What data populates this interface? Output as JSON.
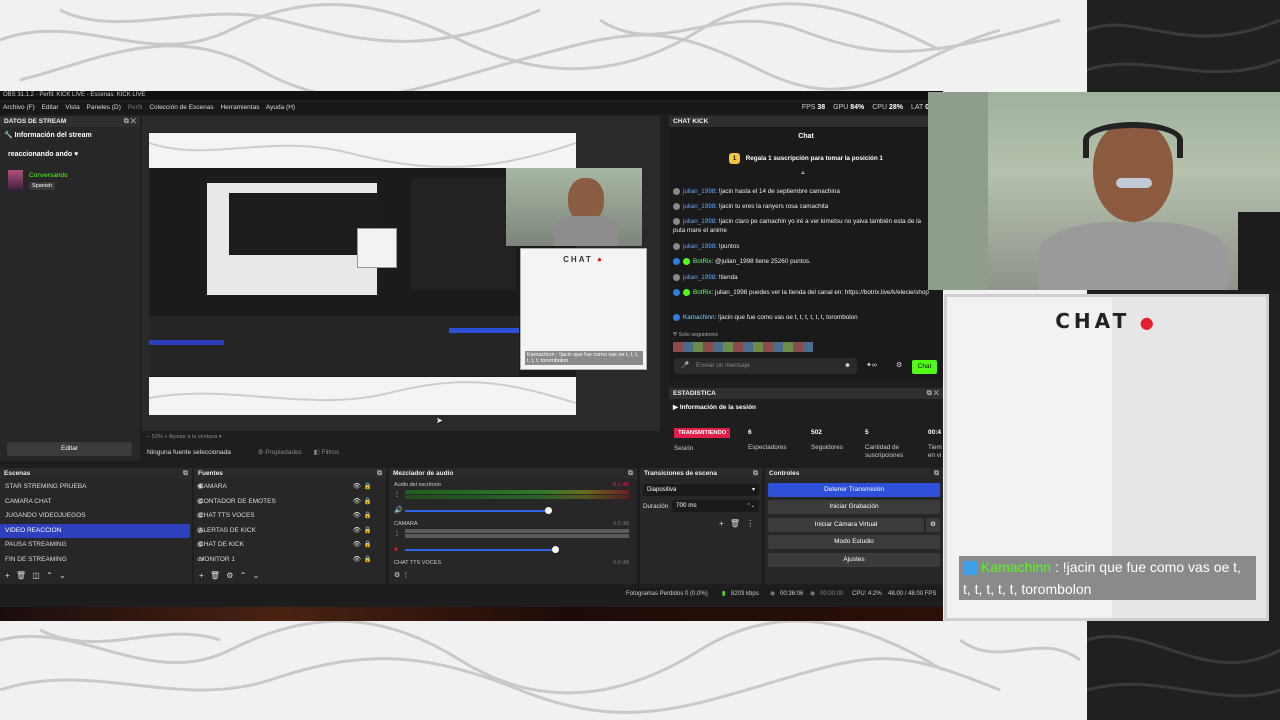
{
  "window": {
    "title": "OBS 31.1.2 - Perfil: KICK LIVE - Escenas: KICK LIVE",
    "menu": [
      "Archivo (F)",
      "Editar",
      "Vista",
      "Paneles (D)",
      "Perfil",
      "Colección de Escenas",
      "Herramientas",
      "Ayuda (H)"
    ],
    "fps_label": "FPS",
    "fps_value": "38",
    "gpu_label": "GPU",
    "gpu_value": "84%",
    "cpu_label": "CPU",
    "cpu_value": "28%",
    "lat_label": "LAT",
    "lat_value": "0"
  },
  "stream_info": {
    "header": "DATOS DE STREAM",
    "section": "Información del stream",
    "title": "reaccionando ando ♥",
    "category": "Conversando",
    "language": "Spanish",
    "edit_button": "Editar"
  },
  "preview": {
    "chat_overlay_title": "CHAT",
    "chat_overlay_message": "Kamachinn : !jacin que fue como vas oe t, t, t, t, t, t, torombolon",
    "zoom_label": "53%",
    "fit_label": "Ajustar a la ventana"
  },
  "source_bar": {
    "no_source": "Ninguna fuente seleccionada",
    "properties": "Propiedades",
    "filters": "Filtros"
  },
  "chat_kick": {
    "header": "CHAT KICK",
    "title": "Chat",
    "gift_text": "Regala 1 suscripción para tomar la posición 1",
    "messages": [
      {
        "user": "julian_1998",
        "text": "!jacin hasta el 14 de septiembre camachina"
      },
      {
        "user": "julian_1998",
        "text": "!jacin tu eres la ranyers rosa camachita"
      },
      {
        "user": "julian_1998",
        "text": "!jacin claro pe camachin yo iré a ver kimetsu no yaiva también esta de la puta mare el anime"
      },
      {
        "user": "julian_1998",
        "text": "!puntos"
      },
      {
        "user": "BotRix",
        "text": "@julian_1998 tiene 25260 puntos."
      },
      {
        "user": "julian_1998",
        "text": "!tienda"
      },
      {
        "user": "BotRix",
        "text": "julian_1998 puedes ver la tienda del canal en: https://botrix.live/k/elecie/shop"
      },
      {
        "user": "Kamachinn",
        "text": "!jacin que fue como vas oe t, t, t, t, t, t, torombolon"
      }
    ],
    "followers_only": "Solo seguidores",
    "input_placeholder": "Enviar un mensaje",
    "send_button": "Chat"
  },
  "statistics": {
    "header": "ESTADISTICA",
    "section": "Información de la sesión",
    "live_badge": "TRANSMITIENDO",
    "session_label": "Sesión",
    "viewers_value": "6",
    "viewers_label": "Espectadores",
    "followers_value": "502",
    "followers_label": "Seguidores",
    "subs_value": "5",
    "subs_label": "Cantidad de suscripciones",
    "time_value": "00:4",
    "time_label": "Tiem en vi"
  },
  "scenes": {
    "header": "Escenas",
    "items": [
      "STAR STREMING PRUEBA",
      "CAMARA CHAT",
      "JUGANDO VIDEOJUEGOS",
      "VIDEO REACCION",
      "PAUSA STREAMING",
      "FIN DE STREAMING"
    ],
    "selected": "VIDEO REACCION"
  },
  "sources": {
    "header": "Fuentes",
    "items": [
      "CAMARA",
      "CONTADOR DE EMOTES",
      "CHAT TTS VOCES",
      "ALERTAS DE KICK",
      "CHAT DE KICK",
      "MONITOR 1"
    ]
  },
  "mixer": {
    "header": "Mezclador de audio",
    "channels": [
      {
        "name": "Audio del escritorio",
        "db": "-8.1 dB",
        "volume": 0.95
      },
      {
        "name": "CAMARA",
        "db": "0.0 dB",
        "volume": 1.0
      },
      {
        "name": "CHAT TTS VOCES",
        "db": "0.0 dB",
        "volume": 1.0
      }
    ],
    "scale": [
      "-60",
      "-55",
      "-50",
      "-45",
      "-40",
      "-35",
      "-30",
      "-25",
      "-20",
      "-15",
      "-10",
      "-5",
      "0"
    ]
  },
  "transitions": {
    "header": "Transiciones de escena",
    "type": "Diapositiva",
    "duration_label": "Duración",
    "duration_value": "700 ms"
  },
  "controls": {
    "header": "Controles",
    "stop_stream": "Detener Transmisión",
    "start_recording": "Iniciar Grabación",
    "virtual_camera": "Iniciar Cámara Virtual",
    "studio_mode": "Modo Estudio",
    "settings": "Ajustes"
  },
  "status": {
    "dropped": "Fotogramas Perdidos 0 (0.0%)",
    "bitrate": "8203 kbps",
    "stream_time": "00:36:06",
    "rec_time": "00:00:00",
    "cpu": "CPU: 4.2%",
    "fps": "48.00 / 48.00 FPS"
  },
  "overlay_chat": {
    "title": "CHAT",
    "user": "Kamachinn",
    "message": ": !jacin que fue como vas oe t, t, t, t, t, t, torombolon"
  },
  "colors": {
    "accent_blue": "#2e50d8",
    "live_red": "#e0204a",
    "kick_green": "#53fc18",
    "record_dot": "#e5202e"
  }
}
